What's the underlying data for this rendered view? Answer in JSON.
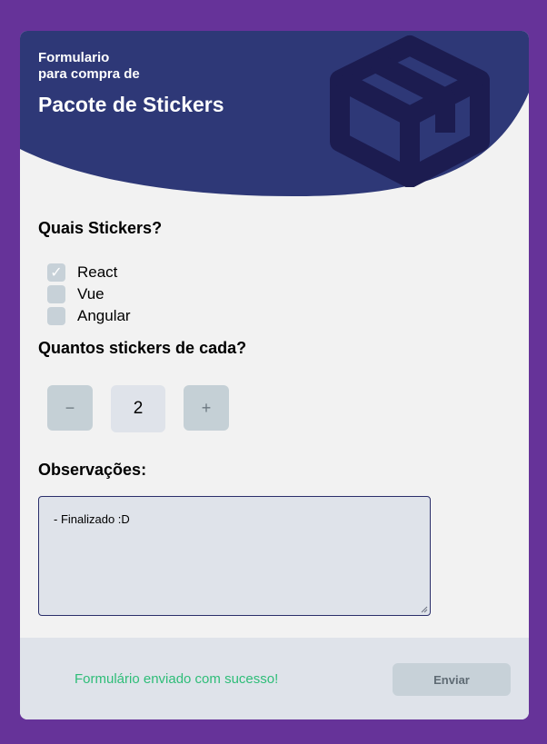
{
  "header": {
    "subtitle": "Formulario\npara compra de",
    "title": "Pacote de Stickers",
    "icon": "package-box-icon"
  },
  "stickers": {
    "question": "Quais Stickers?",
    "options": [
      {
        "label": "React",
        "checked": true
      },
      {
        "label": "Vue",
        "checked": false
      },
      {
        "label": "Angular",
        "checked": false
      }
    ]
  },
  "quantity": {
    "question": "Quantos stickers de cada?",
    "decrement_label": "−",
    "value": "2",
    "increment_label": "+"
  },
  "notes": {
    "label": "Observações:",
    "value": "- Finalizado :D"
  },
  "footer": {
    "success_message": "Formulário enviado com sucesso!",
    "submit_label": "Enviar"
  },
  "colors": {
    "page_background": "#663399",
    "header": "#2e3877",
    "header_icon": "#1c1c50",
    "success": "#2ebd78"
  }
}
